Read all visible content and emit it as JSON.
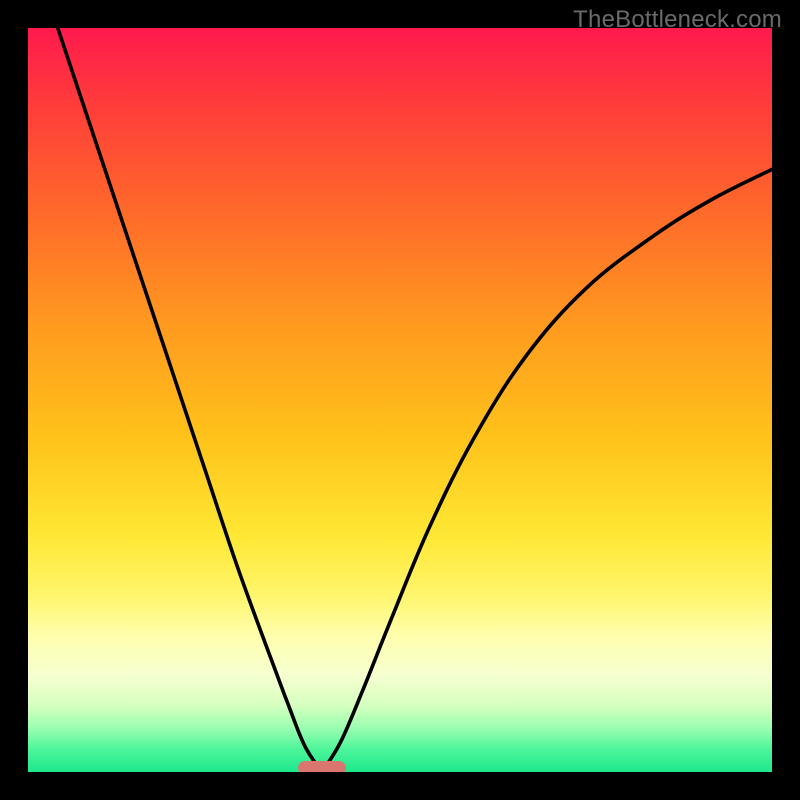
{
  "watermark": "TheBottleneck.com",
  "chart_data": {
    "type": "line",
    "title": "",
    "xlabel": "",
    "ylabel": "",
    "xlim": [
      0,
      1
    ],
    "ylim": [
      0,
      1
    ],
    "grid": false,
    "legend": false,
    "notch_x": 0.395,
    "series": [
      {
        "name": "left-branch",
        "x": [
          0.04,
          0.08,
          0.12,
          0.16,
          0.2,
          0.24,
          0.28,
          0.32,
          0.35,
          0.372,
          0.395
        ],
        "y": [
          1.0,
          0.88,
          0.76,
          0.64,
          0.52,
          0.4,
          0.28,
          0.17,
          0.09,
          0.035,
          0.0
        ]
      },
      {
        "name": "right-branch",
        "x": [
          0.395,
          0.42,
          0.45,
          0.49,
          0.54,
          0.6,
          0.67,
          0.75,
          0.84,
          0.92,
          1.0
        ],
        "y": [
          0.0,
          0.04,
          0.11,
          0.21,
          0.33,
          0.45,
          0.56,
          0.65,
          0.72,
          0.77,
          0.81
        ]
      }
    ],
    "marker": {
      "x": 0.395,
      "y": 0.0,
      "color": "#d8766f"
    },
    "gradient_stops": [
      {
        "pos": 0.0,
        "color": "#ff1a4d"
      },
      {
        "pos": 0.55,
        "color": "#ffc21a"
      },
      {
        "pos": 0.82,
        "color": "#ffffb0"
      },
      {
        "pos": 1.0,
        "color": "#1de78c"
      }
    ]
  }
}
